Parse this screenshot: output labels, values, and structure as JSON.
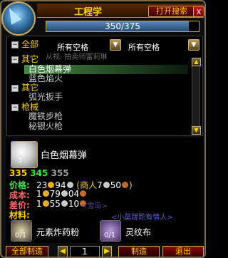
{
  "window": {
    "title": "工程学",
    "open_search_label": "打开搜索",
    "close_label": "x"
  },
  "progress": {
    "text": "350/375",
    "value": 350,
    "max": 375
  },
  "filters": {
    "left_label": "全部",
    "left_value": "所有空格",
    "right_value": "所有空格"
  },
  "ghost_text": "从视: 拍卖师富莉琳",
  "list": [
    {
      "type": "category",
      "label": "其它"
    },
    {
      "type": "recipe",
      "label": "白色烟幕弹",
      "selected": true
    },
    {
      "type": "recipe",
      "label": "蓝色焰火"
    },
    {
      "type": "category",
      "label": "其它"
    },
    {
      "type": "recipe",
      "label": "弧光扳手"
    },
    {
      "type": "category",
      "label": "枪械"
    },
    {
      "type": "recipe",
      "label": "魔铁步枪"
    },
    {
      "type": "recipe",
      "label": "秘银火枪"
    }
  ],
  "detail": {
    "item_name": "白色烟幕弹",
    "item_count": "3",
    "skill_levels": [
      "335",
      "345",
      "355"
    ],
    "price_label": "价格:",
    "price_gold": "23",
    "price_silver": "94",
    "vendor_text": "(商人",
    "vendor_silver": "7",
    "vendor_copper": "50",
    "vendor_close": ")",
    "cost_label": "成本:",
    "cost_gold": "1",
    "cost_silver": "79",
    "cost_copper": "04",
    "diff_label": "差价:",
    "diff_gold": "1",
    "diff_silver": "55",
    "diff_copper": "10",
    "mats_label": "材料:"
  },
  "materials": [
    {
      "name": "元素炸药粉",
      "count": "0/1"
    },
    {
      "name": "灵纹布",
      "count": "0/1"
    }
  ],
  "overlay": {
    "ghost_left": "<雪岛>",
    "ghost_right": "<小莫蹉跎有情人>"
  },
  "footer": {
    "craft_all_label": "全部制造",
    "quantity": "1",
    "craft_label": "制造",
    "exit_label": "退出"
  }
}
